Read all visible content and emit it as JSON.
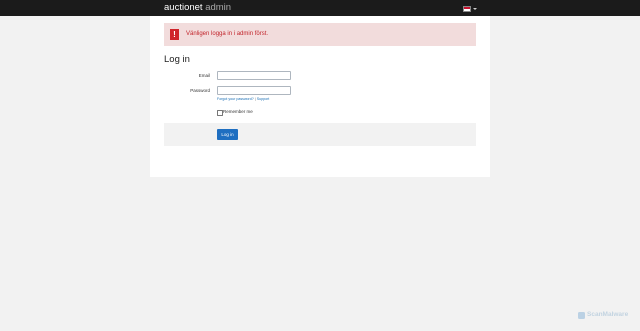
{
  "header": {
    "brand_main": "auctionet",
    "brand_sub": "admin",
    "language": "flag-icon"
  },
  "alert": {
    "icon": "!",
    "message": "Vänligen logga in i admin först."
  },
  "page": {
    "title": "Log in"
  },
  "form": {
    "email_label": "Email",
    "email_value": "",
    "password_label": "Password",
    "password_value": "",
    "forgot_link": "Forgot your password?",
    "separator": "|",
    "support_link": "Support",
    "remember_label": "Remember me",
    "remember_checked": false,
    "submit_label": "Log in"
  },
  "watermark": {
    "text": "ScanMalware"
  },
  "colors": {
    "topbar": "#1b1b1b",
    "alert_bg": "#f2dcdc",
    "alert_text": "#c2242b",
    "primary": "#1f6fc1",
    "link": "#1b6fb5"
  }
}
